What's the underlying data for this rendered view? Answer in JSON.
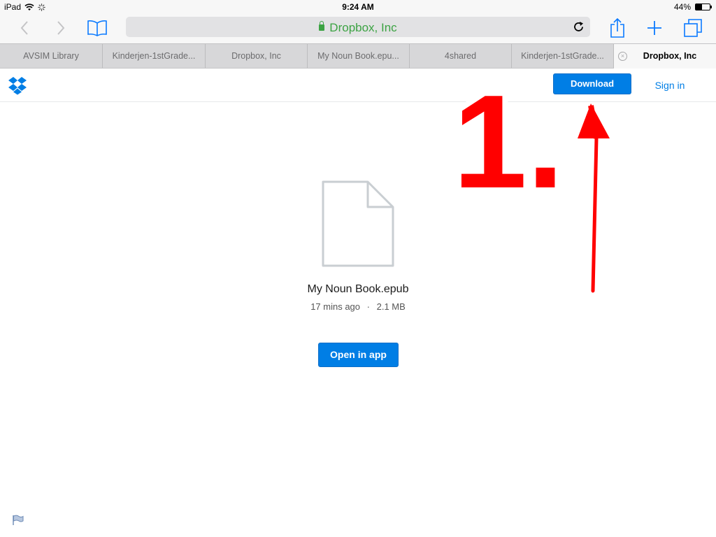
{
  "status_bar": {
    "device": "iPad",
    "time": "9:24 AM",
    "battery_percent_label": "44%",
    "battery_level": 0.44
  },
  "toolbar": {
    "url_label": "Dropbox, Inc",
    "icons": [
      "back-icon",
      "forward-icon",
      "bookmarks-icon",
      "lock-icon",
      "reload-icon",
      "share-icon",
      "new-tab-icon",
      "tabs-icon"
    ]
  },
  "tabs": [
    {
      "label": "AVSIM Library"
    },
    {
      "label": "Kinderjen-1stGrade..."
    },
    {
      "label": "Dropbox, Inc"
    },
    {
      "label": "My Noun Book.epu..."
    },
    {
      "label": "4shared"
    },
    {
      "label": "Kinderjen-1stGrade..."
    },
    {
      "label": "Dropbox, Inc",
      "active": true
    }
  ],
  "header": {
    "download_label": "Download",
    "signin_label": "Sign in"
  },
  "file": {
    "name": "My Noun Book.epub",
    "modified": "17 mins ago",
    "separator": "·",
    "size": "2.1 MB",
    "open_label": "Open in app"
  },
  "annotation": {
    "label": "1.",
    "color": "#ff0000"
  },
  "colors": {
    "accent": "#007ee5",
    "url_green": "#3ca343"
  }
}
